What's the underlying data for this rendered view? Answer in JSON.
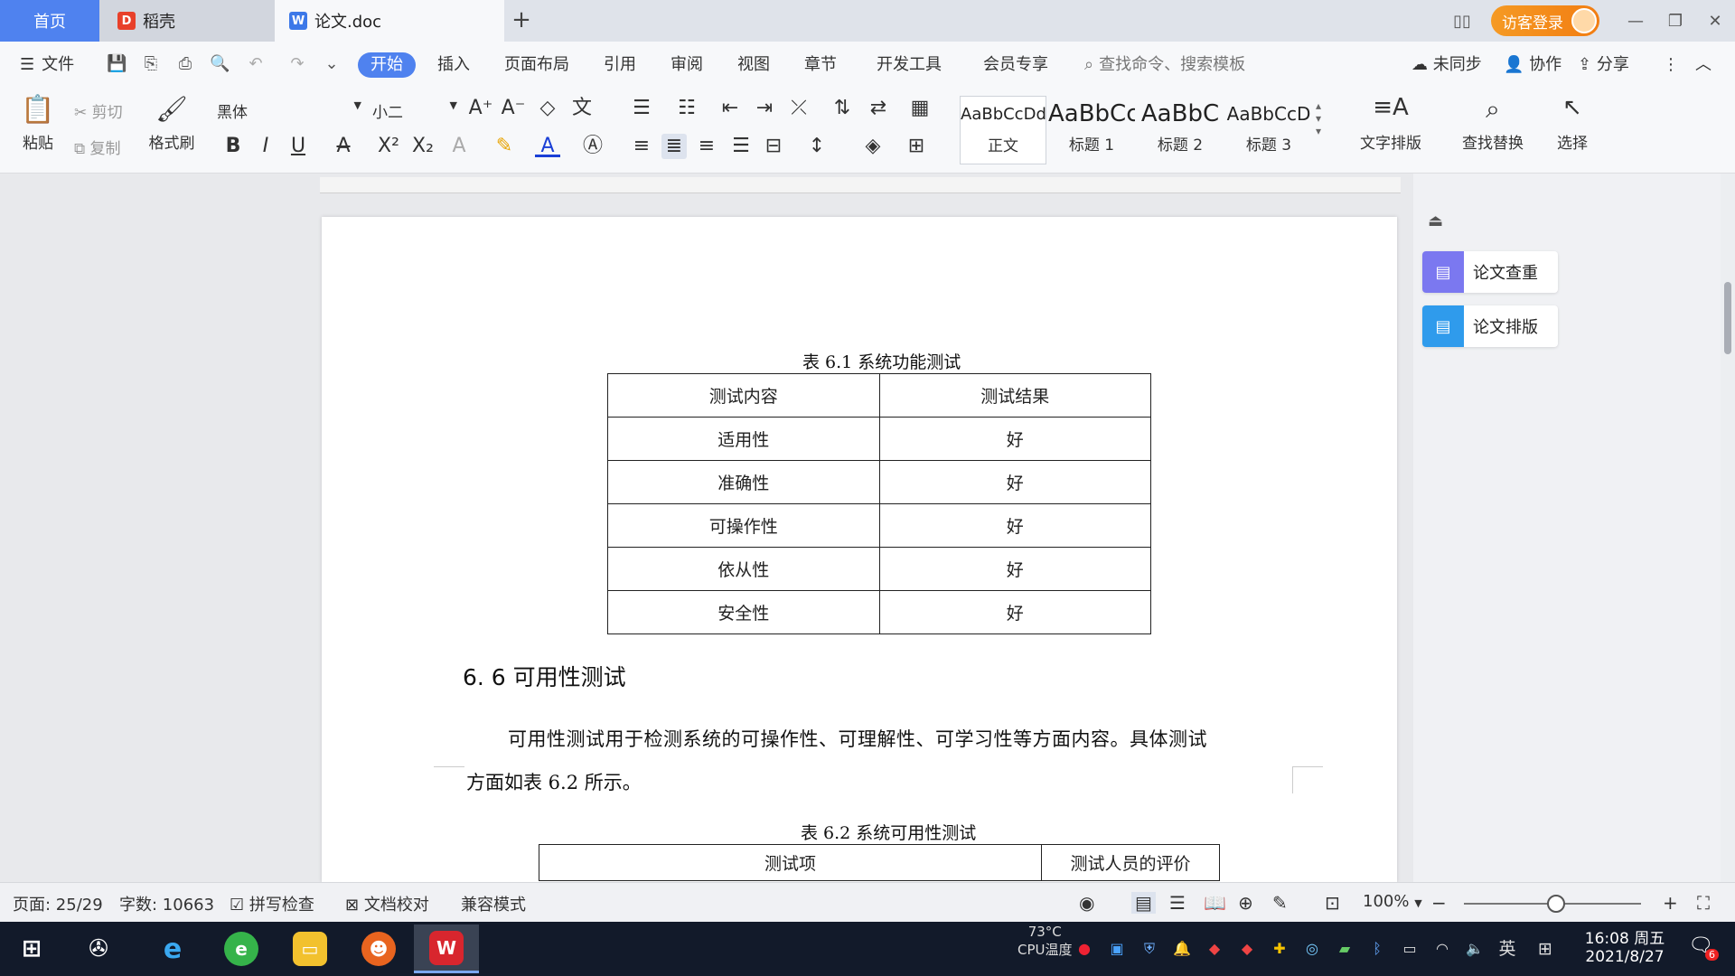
{
  "tabs": {
    "home": "首页",
    "daoke": "稻壳",
    "doc": "论文.doc"
  },
  "header": {
    "login": "访客登录"
  },
  "menu": {
    "file": "文件",
    "start": "开始",
    "insert": "插入",
    "layout": "页面布局",
    "reference": "引用",
    "review": "审阅",
    "view": "视图",
    "chapter": "章节",
    "devtools": "开发工具",
    "member": "会员专享",
    "search_placeholder": "查找命令、搜索模板",
    "sync": "未同步",
    "collab": "协作",
    "share": "分享"
  },
  "ribbon": {
    "paste": "粘贴",
    "cut": "剪切",
    "copy": "复制",
    "format_painter": "格式刷",
    "font_name": "黑体",
    "font_size": "小二",
    "styles": [
      {
        "sample": "AaBbCcDd",
        "name": "正文"
      },
      {
        "sample": "AaBbCc",
        "name": "标题 1"
      },
      {
        "sample": "AaBbC",
        "name": "标题 2"
      },
      {
        "sample": "AaBbCcD",
        "name": "标题 3"
      }
    ],
    "text_layout": "文字排版",
    "find_replace": "查找替换",
    "select": "选择"
  },
  "document": {
    "table1_caption": "表 6.1    系统功能测试",
    "table1_headers": [
      "测试内容",
      "测试结果"
    ],
    "table1_rows": [
      [
        "适用性",
        "好"
      ],
      [
        "准确性",
        "好"
      ],
      [
        "可操作性",
        "好"
      ],
      [
        "依从性",
        "好"
      ],
      [
        "安全性",
        "好"
      ]
    ],
    "section_heading": "6. 6 可用性测试",
    "paragraph_line1": "可用性测试用于检测系统的可操作性、可理解性、可学习性等方面内容。具体测试",
    "paragraph_line2": "方面如表 6.2 所示。",
    "table2_caption": "表 6.2  系统可用性测试",
    "table2_headers": [
      "测试项",
      "测试人员的评价"
    ]
  },
  "side_panel": {
    "check": "论文查重",
    "format": "论文排版"
  },
  "status": {
    "page": "页面: 25/29",
    "words": "字数: 10663",
    "spell": "拼写检查",
    "proof": "文档校对",
    "compat": "兼容模式",
    "zoom": "100%",
    "zoom_fraction": 0.5
  },
  "taskbar": {
    "temp": "73°C",
    "cpu_label": "CPU温度",
    "ime": "英",
    "time": "16:08 周五",
    "date": "2021/8/27",
    "notify_count": "6"
  },
  "colors": {
    "accent": "#4f82ef",
    "login_orange": "#f27d12",
    "taskbar": "#121a2a"
  }
}
